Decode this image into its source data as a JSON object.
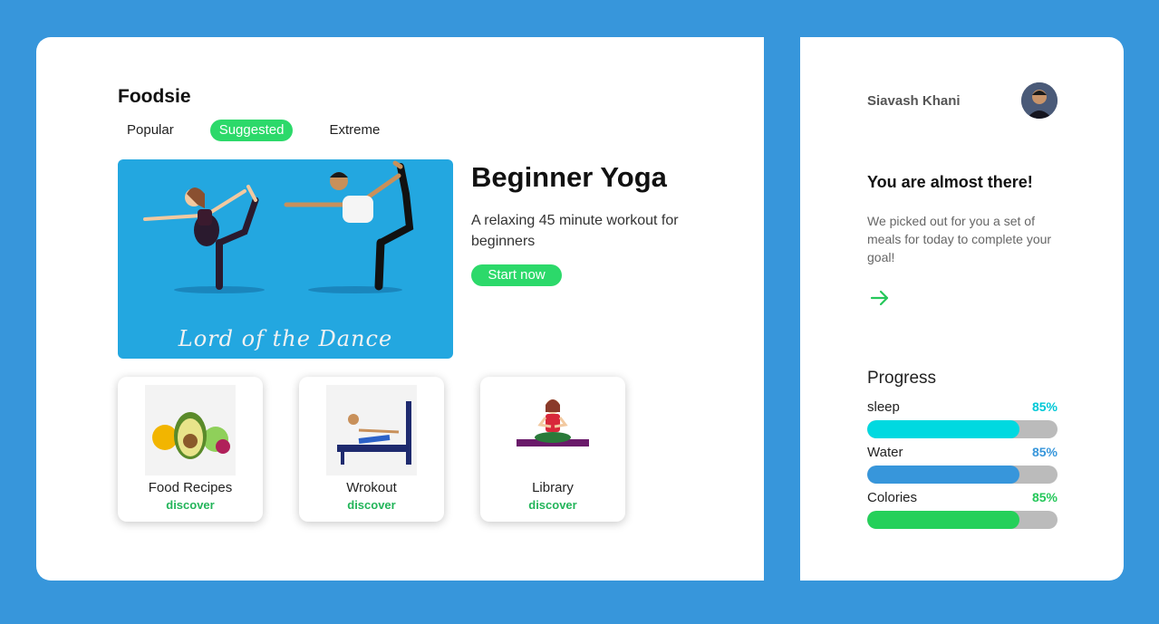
{
  "app": {
    "brand": "Foodsie"
  },
  "tabs": [
    {
      "label": "Popular",
      "active": false
    },
    {
      "label": "Suggested",
      "active": true
    },
    {
      "label": "Extreme",
      "active": false
    }
  ],
  "hero": {
    "image_caption": "Lord of the Dance",
    "title": "Beginner Yoga",
    "description": "A relaxing 45 minute workout for beginners",
    "button_label": "Start now"
  },
  "tiles": [
    {
      "label": "Food Recipes",
      "link": "discover",
      "icon": "food-icon"
    },
    {
      "label": "Wrokout",
      "link": "discover",
      "icon": "workout-icon"
    },
    {
      "label": "Library",
      "link": "discover",
      "icon": "meditation-icon"
    }
  ],
  "user": {
    "name": "Siavash Khani"
  },
  "promo": {
    "title": "You are almost there!",
    "description": "We picked out for you a set of meals for today to complete your goal!",
    "arrow_icon": "arrow-right-icon"
  },
  "progress": {
    "title": "Progress",
    "items": [
      {
        "label": "sleep",
        "value_text": "85%",
        "value": 0.8,
        "color": "#00d9e0"
      },
      {
        "label": "Water",
        "value_text": "85%",
        "value": 0.8,
        "color": "#3796db"
      },
      {
        "label": "Colories",
        "value_text": "85%",
        "value": 0.8,
        "color": "#25d05a"
      }
    ]
  },
  "colors": {
    "background": "#3796db",
    "accent": "#2cd96a",
    "link": "#23b55a"
  }
}
